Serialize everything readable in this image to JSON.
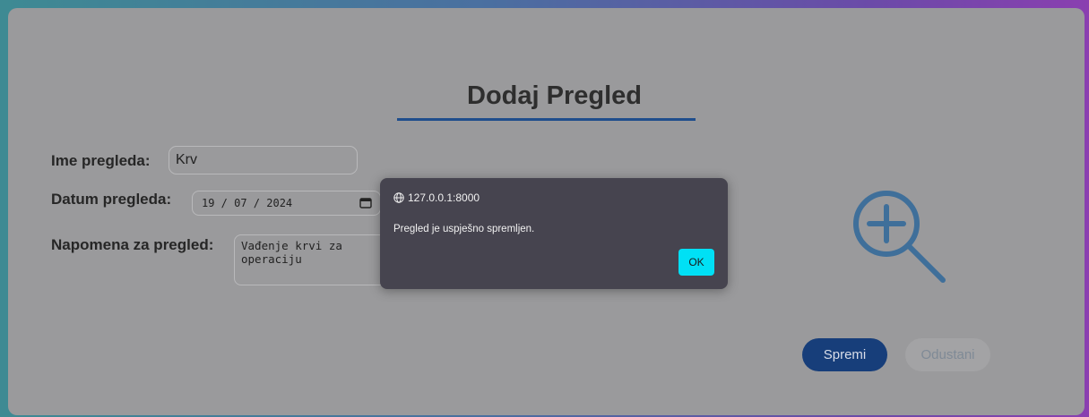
{
  "form": {
    "title": "Dodaj Pregled",
    "name_label": "Ime pregleda:",
    "name_value": "Krv",
    "date_label": "Datum pregleda:",
    "date_value": "19 / 07 / 2024",
    "note_label": "Napomena za pregled:",
    "note_value": "Vađenje krvi za\noperaciju",
    "save_label": "Spremi",
    "cancel_label": "Odustani"
  },
  "dialog": {
    "origin": "127.0.0.1:8000",
    "message": "Pregled je uspješno spremljen.",
    "ok_label": "OK"
  },
  "icons": {
    "zoom": "zoom-in-icon",
    "calendar": "calendar-icon",
    "globe": "globe-icon"
  },
  "colors": {
    "accent": "#173e7a",
    "underline": "#1f4d8c",
    "dialog_ok": "#00e0f5",
    "dialog_bg": "#46444f"
  }
}
